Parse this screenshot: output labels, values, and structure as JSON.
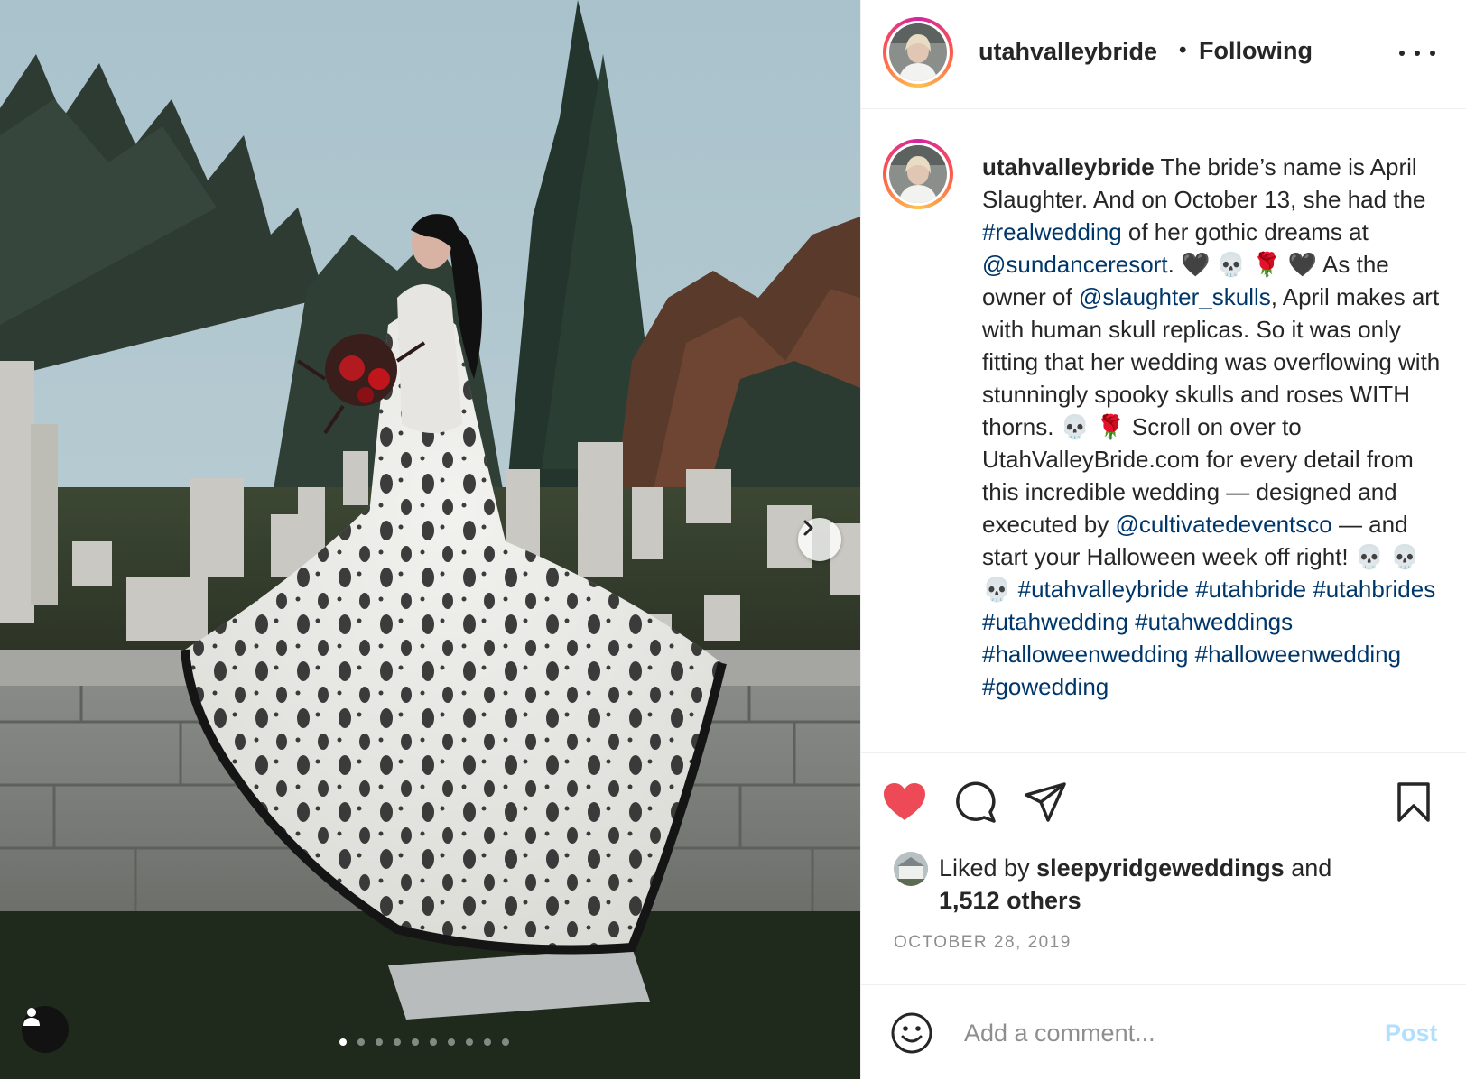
{
  "post": {
    "username": "utahvalleybride",
    "separator": "•",
    "follow_status": "Following",
    "media": {
      "icons": {
        "next": "chevron-right-icon",
        "tag": "user-tag-icon"
      },
      "carousel_count": 10,
      "carousel_index": 1
    },
    "caption": {
      "username": "utahvalleybride",
      "segments": [
        {
          "t": "text",
          "v": " The bride’s name is April Slaughter. And on October 13, she had the "
        },
        {
          "t": "link",
          "v": "#realwedding"
        },
        {
          "t": "text",
          "v": " of her gothic dreams at "
        },
        {
          "t": "link",
          "v": "@sundanceresort"
        },
        {
          "t": "text",
          "v": ". 🖤 💀 🌹 🖤  As the owner of "
        },
        {
          "t": "link",
          "v": "@slaughter_skulls"
        },
        {
          "t": "text",
          "v": ", April makes art with human skull replicas. So it was only fitting that her wedding was overflowing with stunningly spooky skulls and roses WITH thorns.  💀 🌹  Scroll on over to UtahValleyBride.com for every detail from this incredible wedding — designed and executed by "
        },
        {
          "t": "link",
          "v": "@cultivatedeventsco"
        },
        {
          "t": "text",
          "v": " — and start your Halloween week off right!  💀 💀 💀 "
        },
        {
          "t": "link",
          "v": "#utahvalleybride"
        },
        {
          "t": "text",
          "v": " "
        },
        {
          "t": "link",
          "v": "#utahbride"
        },
        {
          "t": "text",
          "v": " "
        },
        {
          "t": "link",
          "v": "#utahbrides"
        },
        {
          "t": "text",
          "v": " "
        },
        {
          "t": "link",
          "v": "#utahwedding"
        },
        {
          "t": "text",
          "v": " "
        },
        {
          "t": "link",
          "v": "#utahweddings"
        },
        {
          "t": "text",
          "v": " "
        },
        {
          "t": "link",
          "v": "#halloweenwedding"
        },
        {
          "t": "text",
          "v": " "
        },
        {
          "t": "link",
          "v": "#halloweenwedding"
        },
        {
          "t": "text",
          "v": " "
        },
        {
          "t": "link",
          "v": "#gowedding"
        }
      ]
    },
    "actions": {
      "liked": true,
      "icons": [
        "heart-icon",
        "comment-icon",
        "share-icon",
        "bookmark-icon"
      ],
      "like_color": "#ed4956"
    },
    "likes": {
      "prefix": "Liked by",
      "user": "sleepyridgeweddings",
      "connector": "and",
      "others": "1,512 others"
    },
    "date": "OCTOBER 28, 2019",
    "comment": {
      "placeholder": "Add a comment...",
      "post_label": "Post",
      "post_color": "#b2dffc"
    }
  },
  "colors": {
    "link": "#00376b",
    "text": "#262626",
    "muted": "#8e8e8e"
  }
}
